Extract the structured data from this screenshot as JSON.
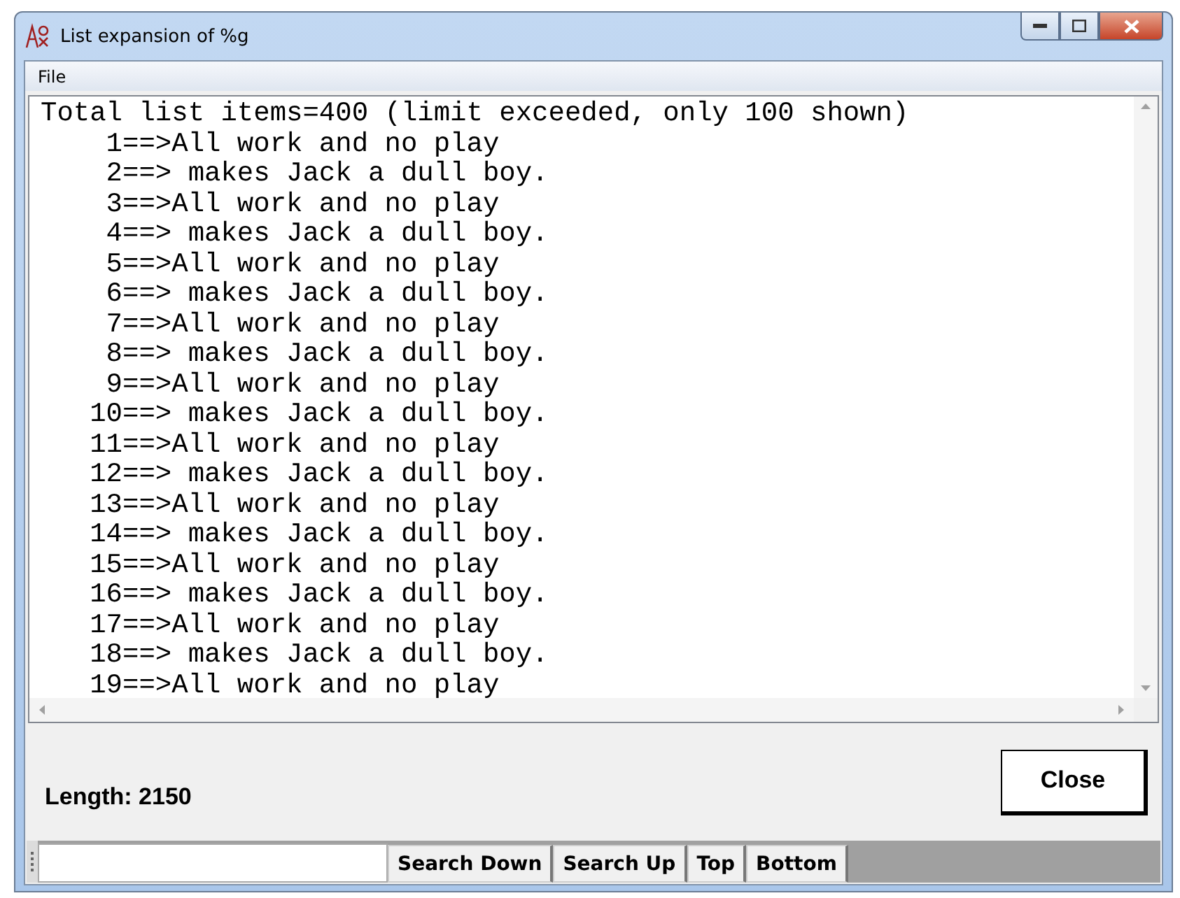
{
  "window": {
    "title": "List expansion of %g"
  },
  "menu": [
    "File"
  ],
  "lines": [
    "Total list items=400 (limit exceeded, only 100 shown)",
    "    1==>All work and no play",
    "    2==> makes Jack a dull boy.",
    "    3==>All work and no play",
    "    4==> makes Jack a dull boy.",
    "    5==>All work and no play",
    "    6==> makes Jack a dull boy.",
    "    7==>All work and no play",
    "    8==> makes Jack a dull boy.",
    "    9==>All work and no play",
    "   10==> makes Jack a dull boy.",
    "   11==>All work and no play",
    "   12==> makes Jack a dull boy.",
    "   13==>All work and no play",
    "   14==> makes Jack a dull boy.",
    "   15==>All work and no play",
    "   16==> makes Jack a dull boy.",
    "   17==>All work and no play",
    "   18==> makes Jack a dull boy.",
    "   19==>All work and no play"
  ],
  "length_label": "Length: 2150",
  "close_button": "Close",
  "search_bar": {
    "buttons": [
      "Search Down",
      "Search Up",
      "Top",
      "Bottom"
    ]
  }
}
